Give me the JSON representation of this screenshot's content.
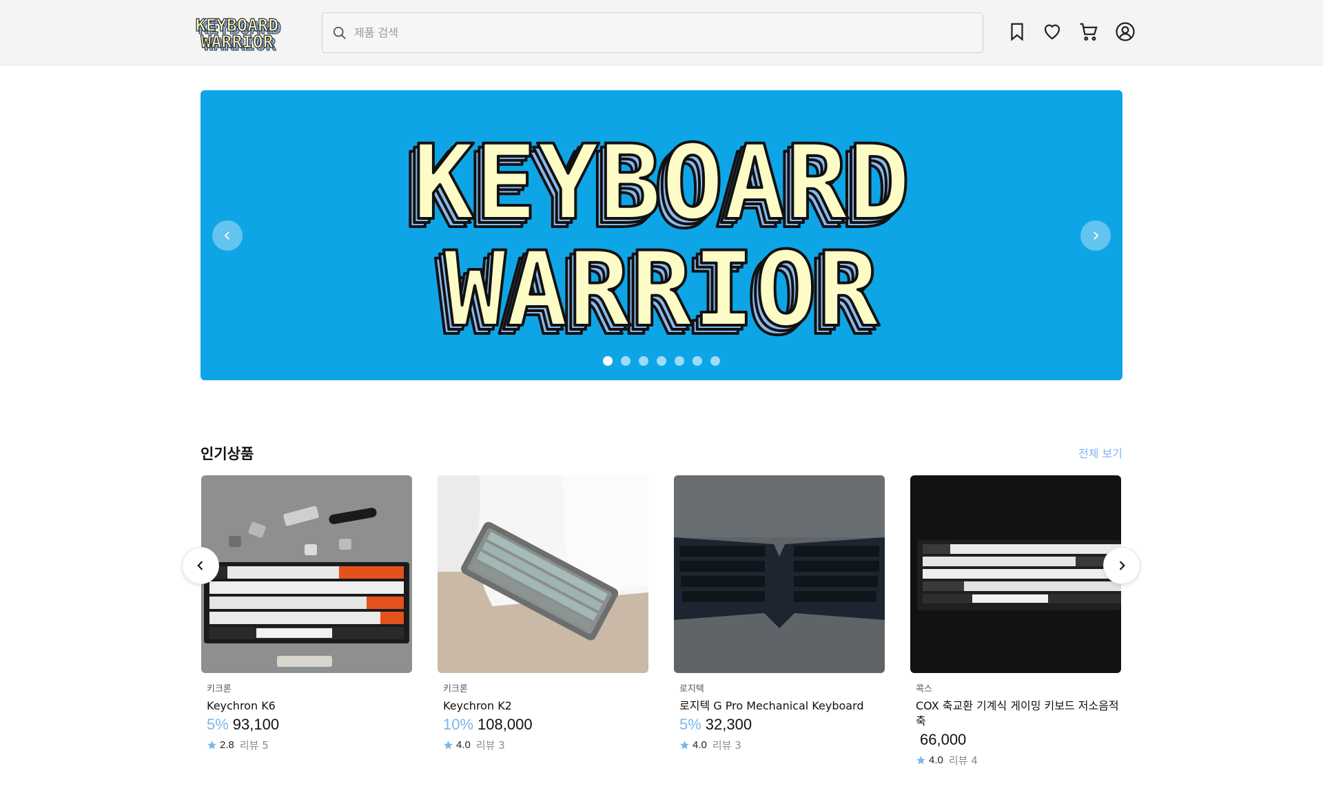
{
  "header": {
    "logo_alt": "KEYBOARD WARRIOR",
    "search": {
      "placeholder": "제품 검색",
      "value": ""
    },
    "icons": [
      "bookmark-icon",
      "heart-icon",
      "cart-icon",
      "user-icon"
    ]
  },
  "banner": {
    "art_text_line1": "KEYBOARD",
    "art_text_line2": "WARRIOR",
    "slide_count": 7,
    "active_slide": 1,
    "background_color": "#0ea5e7"
  },
  "popular": {
    "title": "인기상품",
    "see_all": "전체 보기",
    "products": [
      {
        "brand": "키크론",
        "name": "Keychron K6",
        "discount": "5%",
        "price": "93,100",
        "rating": "2.8",
        "review_label": "리뷰 5"
      },
      {
        "brand": "키크론",
        "name": "Keychron K2",
        "discount": "10%",
        "price": "108,000",
        "rating": "4.0",
        "review_label": "리뷰 3"
      },
      {
        "brand": "로지텍",
        "name": "로지텍 G Pro Mechanical Keyboard",
        "discount": "5%",
        "price": "32,300",
        "rating": "4.0",
        "review_label": "리뷰 3"
      },
      {
        "brand": "콕스",
        "name": "COX 축교환 기계식 게이밍 키보드 저소음적축",
        "discount": "",
        "price": "66,000",
        "rating": "4.0",
        "review_label": "리뷰 4"
      }
    ]
  },
  "colors": {
    "accent": "#7cb6ee",
    "banner": "#0ea5e7",
    "logo_fill": "#fdfbc6",
    "logo_shadow": "#8ab8ec"
  }
}
